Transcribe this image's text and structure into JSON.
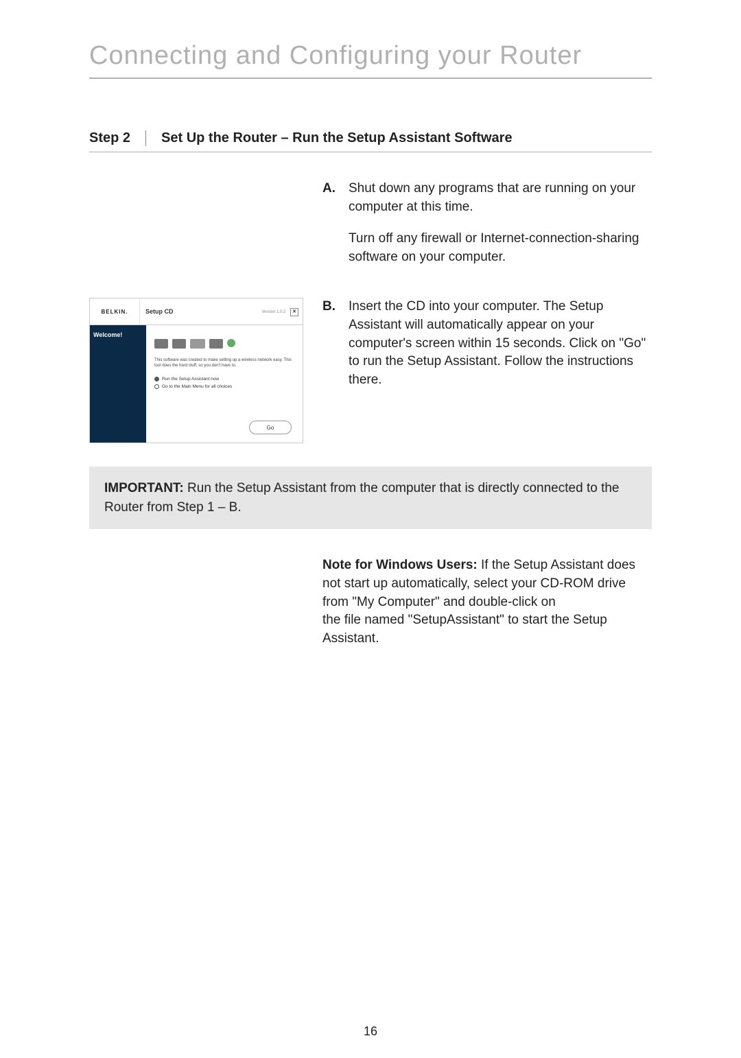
{
  "title": "Connecting and Configuring your Router",
  "step": {
    "label": "Step 2",
    "title": "Set Up the Router – Run the Setup Assistant Software"
  },
  "instructionA": {
    "letter": "A.",
    "p1": "Shut down any programs that are running on your computer at this time.",
    "p2": "Turn off any firewall or Internet-connection-sharing software on your computer."
  },
  "instructionB": {
    "letter": "B.",
    "p1": "Insert the CD into your computer. The Setup Assistant will automatically appear on your computer's screen within 15 seconds. Click on \"Go\" to run the Setup Assistant. Follow the instructions there."
  },
  "mini": {
    "brand": "BELKIN.",
    "title": "Setup CD",
    "version": "Version 1.0.2",
    "side": "Welcome!",
    "desc": "This software was created to make setting up a wireless network easy. This tool does the hard stuff, so you don't have to.",
    "radio1": "Run the Setup Assistant now",
    "radio2": "Go to the Main Menu for all choices",
    "go": "Go"
  },
  "important": {
    "bold": "IMPORTANT:",
    "text": " Run the Setup Assistant from the computer that is directly connected to the Router from Step 1 – B."
  },
  "note": {
    "bold": "Note for Windows Users:",
    "text1": " If the Setup Assistant does not start up automatically, select your CD-ROM drive from \"My Computer\" and double-click on",
    "text2": "the file named \"SetupAssistant\" to start the Setup Assistant."
  },
  "pageNumber": "16"
}
